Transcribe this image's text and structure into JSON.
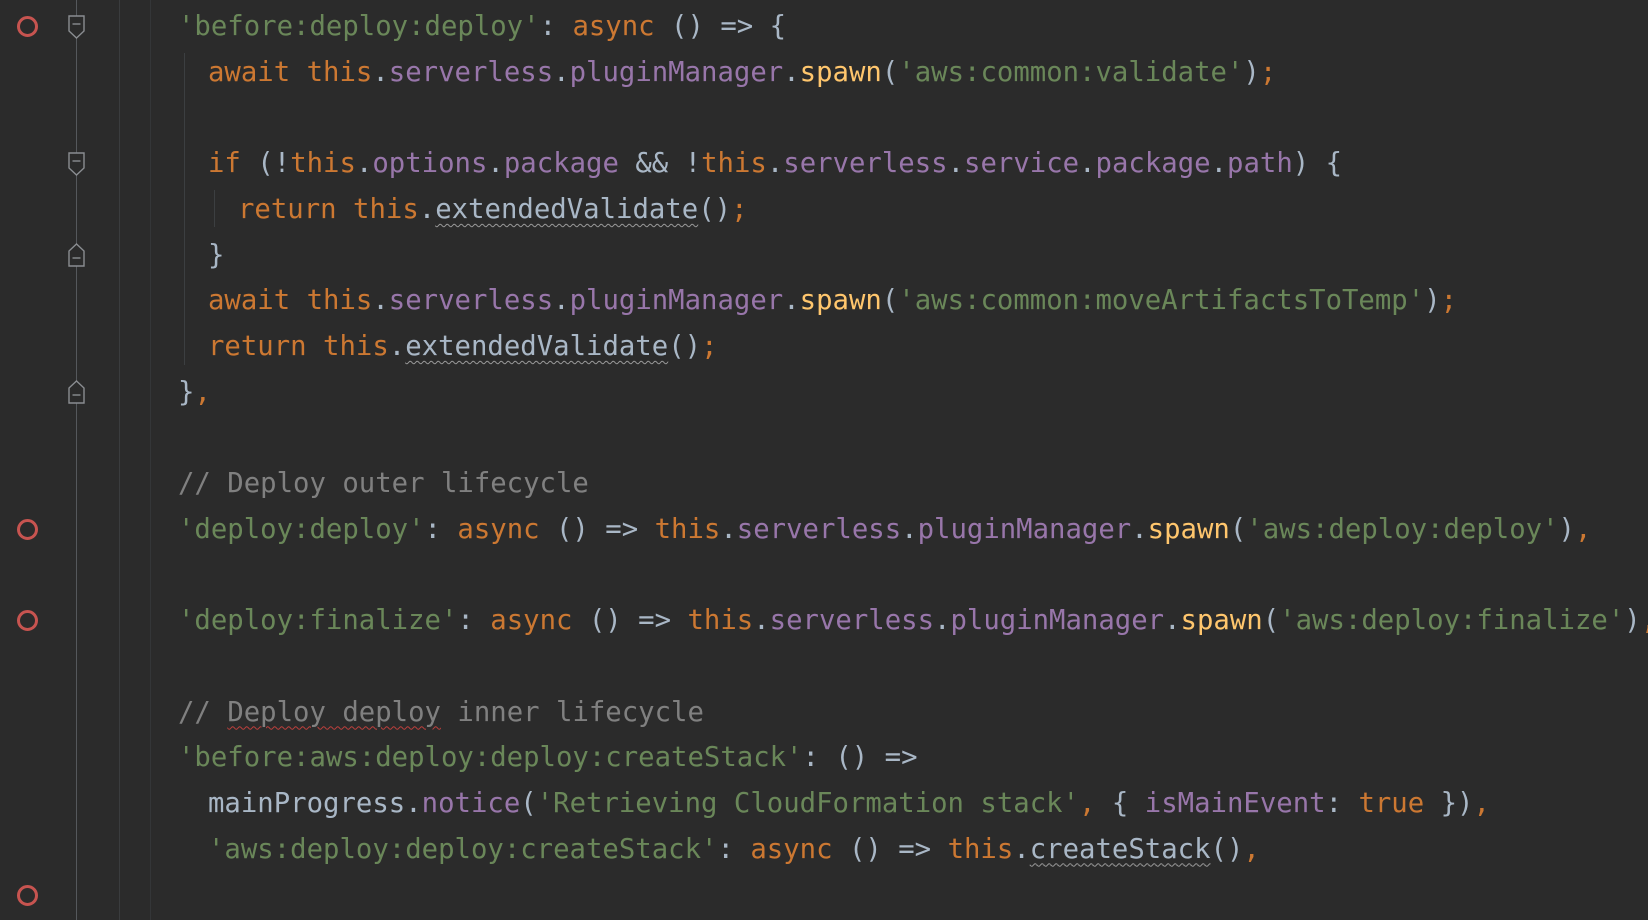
{
  "editor": {
    "lines": [
      {
        "tokens": [
          {
            "t": "'before:deploy:deploy'",
            "c": "str"
          },
          {
            "t": ": ",
            "c": "plain"
          },
          {
            "t": "async",
            "c": "kw"
          },
          {
            "t": " () => {",
            "c": "plain"
          }
        ]
      },
      {
        "tokens": [
          {
            "t": "await",
            "c": "kw"
          },
          {
            "t": " ",
            "c": "plain"
          },
          {
            "t": "this",
            "c": "kw"
          },
          {
            "t": ".",
            "c": "plain"
          },
          {
            "t": "serverless",
            "c": "prop"
          },
          {
            "t": ".",
            "c": "plain"
          },
          {
            "t": "pluginManager",
            "c": "prop"
          },
          {
            "t": ".",
            "c": "plain"
          },
          {
            "t": "spawn",
            "c": "fn"
          },
          {
            "t": "(",
            "c": "plain"
          },
          {
            "t": "'aws:common:validate'",
            "c": "str"
          },
          {
            "t": ")",
            "c": "plain"
          },
          {
            "t": ";",
            "c": "kw"
          }
        ]
      },
      {
        "tokens": []
      },
      {
        "tokens": [
          {
            "t": "if",
            "c": "kw"
          },
          {
            "t": " (!",
            "c": "plain"
          },
          {
            "t": "this",
            "c": "kw"
          },
          {
            "t": ".",
            "c": "plain"
          },
          {
            "t": "options",
            "c": "prop"
          },
          {
            "t": ".",
            "c": "plain"
          },
          {
            "t": "package",
            "c": "prop"
          },
          {
            "t": " && !",
            "c": "plain"
          },
          {
            "t": "this",
            "c": "kw"
          },
          {
            "t": ".",
            "c": "plain"
          },
          {
            "t": "serverless",
            "c": "prop"
          },
          {
            "t": ".",
            "c": "plain"
          },
          {
            "t": "service",
            "c": "prop"
          },
          {
            "t": ".",
            "c": "plain"
          },
          {
            "t": "package",
            "c": "prop"
          },
          {
            "t": ".",
            "c": "plain"
          },
          {
            "t": "path",
            "c": "prop"
          },
          {
            "t": ") {",
            "c": "plain"
          }
        ]
      },
      {
        "tokens": [
          {
            "t": "return",
            "c": "kw"
          },
          {
            "t": " ",
            "c": "plain"
          },
          {
            "t": "this",
            "c": "kw"
          },
          {
            "t": ".",
            "c": "plain"
          },
          {
            "t": "extendedValidate",
            "c": "plain squig"
          },
          {
            "t": "()",
            "c": "plain"
          },
          {
            "t": ";",
            "c": "kw"
          }
        ]
      },
      {
        "tokens": [
          {
            "t": "}",
            "c": "plain"
          }
        ]
      },
      {
        "tokens": [
          {
            "t": "await",
            "c": "kw"
          },
          {
            "t": " ",
            "c": "plain"
          },
          {
            "t": "this",
            "c": "kw"
          },
          {
            "t": ".",
            "c": "plain"
          },
          {
            "t": "serverless",
            "c": "prop"
          },
          {
            "t": ".",
            "c": "plain"
          },
          {
            "t": "pluginManager",
            "c": "prop"
          },
          {
            "t": ".",
            "c": "plain"
          },
          {
            "t": "spawn",
            "c": "fn"
          },
          {
            "t": "(",
            "c": "plain"
          },
          {
            "t": "'aws:common:moveArtifactsToTemp'",
            "c": "str"
          },
          {
            "t": ")",
            "c": "plain"
          },
          {
            "t": ";",
            "c": "kw"
          }
        ]
      },
      {
        "tokens": [
          {
            "t": "return",
            "c": "kw"
          },
          {
            "t": " ",
            "c": "plain"
          },
          {
            "t": "this",
            "c": "kw"
          },
          {
            "t": ".",
            "c": "plain"
          },
          {
            "t": "extendedValidate",
            "c": "plain squig"
          },
          {
            "t": "()",
            "c": "plain"
          },
          {
            "t": ";",
            "c": "kw"
          }
        ]
      },
      {
        "tokens": [
          {
            "t": "}",
            "c": "plain"
          },
          {
            "t": ",",
            "c": "kw"
          }
        ]
      },
      {
        "tokens": []
      },
      {
        "tokens": [
          {
            "t": "// Deploy outer lifecycle",
            "c": "com"
          }
        ]
      },
      {
        "tokens": [
          {
            "t": "'deploy:deploy'",
            "c": "str"
          },
          {
            "t": ": ",
            "c": "plain"
          },
          {
            "t": "async",
            "c": "kw"
          },
          {
            "t": " () => ",
            "c": "plain"
          },
          {
            "t": "this",
            "c": "kw"
          },
          {
            "t": ".",
            "c": "plain"
          },
          {
            "t": "serverless",
            "c": "prop"
          },
          {
            "t": ".",
            "c": "plain"
          },
          {
            "t": "pluginManager",
            "c": "prop"
          },
          {
            "t": ".",
            "c": "plain"
          },
          {
            "t": "spawn",
            "c": "fn"
          },
          {
            "t": "(",
            "c": "plain"
          },
          {
            "t": "'aws:deploy:deploy'",
            "c": "str"
          },
          {
            "t": ")",
            "c": "plain"
          },
          {
            "t": ",",
            "c": "kw"
          }
        ]
      },
      {
        "tokens": []
      },
      {
        "tokens": [
          {
            "t": "'deploy:finalize'",
            "c": "str"
          },
          {
            "t": ": ",
            "c": "plain"
          },
          {
            "t": "async",
            "c": "kw"
          },
          {
            "t": " () => ",
            "c": "plain"
          },
          {
            "t": "this",
            "c": "kw"
          },
          {
            "t": ".",
            "c": "plain"
          },
          {
            "t": "serverless",
            "c": "prop"
          },
          {
            "t": ".",
            "c": "plain"
          },
          {
            "t": "pluginManager",
            "c": "prop"
          },
          {
            "t": ".",
            "c": "plain"
          },
          {
            "t": "spawn",
            "c": "fn"
          },
          {
            "t": "(",
            "c": "plain"
          },
          {
            "t": "'aws:deploy:finalize'",
            "c": "str"
          },
          {
            "t": ")",
            "c": "plain"
          },
          {
            "t": ",",
            "c": "kw"
          }
        ]
      },
      {
        "tokens": []
      },
      {
        "tokens": [
          {
            "t": "// ",
            "c": "com"
          },
          {
            "t": "Deploy deploy",
            "c": "com typo"
          },
          {
            "t": " inner lifecycle",
            "c": "com"
          }
        ]
      },
      {
        "tokens": [
          {
            "t": "'before:aws:deploy:deploy:createStack'",
            "c": "str"
          },
          {
            "t": ": () =>",
            "c": "plain"
          }
        ]
      },
      {
        "tokens": [
          {
            "t": "mainProgress",
            "c": "plain"
          },
          {
            "t": ".",
            "c": "plain"
          },
          {
            "t": "notice",
            "c": "prop"
          },
          {
            "t": "(",
            "c": "plain"
          },
          {
            "t": "'Retrieving CloudFormation stack'",
            "c": "str"
          },
          {
            "t": ", ",
            "c": "kw"
          },
          {
            "t": "{ ",
            "c": "plain"
          },
          {
            "t": "isMainEvent",
            "c": "prop"
          },
          {
            "t": ": ",
            "c": "plain"
          },
          {
            "t": "true",
            "c": "kw"
          },
          {
            "t": " })",
            "c": "plain"
          },
          {
            "t": ",",
            "c": "kw"
          }
        ]
      },
      {
        "tokens": [
          {
            "t": "'aws:deploy:deploy:createStack'",
            "c": "str"
          },
          {
            "t": ": ",
            "c": "plain"
          },
          {
            "t": "async",
            "c": "kw"
          },
          {
            "t": " () => ",
            "c": "plain"
          },
          {
            "t": "this",
            "c": "kw"
          },
          {
            "t": ".",
            "c": "plain"
          },
          {
            "t": "createStack",
            "c": "plain squig"
          },
          {
            "t": "()",
            "c": "plain"
          },
          {
            "t": ",",
            "c": "kw"
          }
        ]
      }
    ]
  },
  "gutter": {
    "breakpoint_lines": [
      0,
      11,
      13,
      19
    ],
    "fold_markers": [
      {
        "line": 0,
        "kind": "fold-open"
      },
      {
        "line": 3,
        "kind": "fold-open"
      },
      {
        "line": 5,
        "kind": "fold-close"
      },
      {
        "line": 8,
        "kind": "fold-close"
      }
    ]
  },
  "colors": {
    "background": "#2b2b2b",
    "keyword": "#cc7832",
    "function": "#ffc66d",
    "property": "#9876aa",
    "string": "#6a8759",
    "comment": "#808080",
    "plain": "#a9b7c6",
    "breakpoint": "#c75450"
  }
}
